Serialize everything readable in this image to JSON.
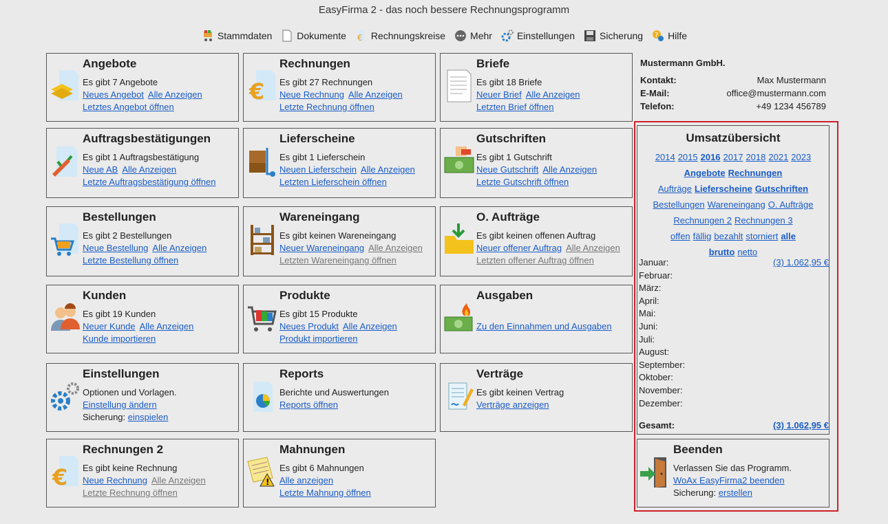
{
  "window": {
    "title": "EasyFirma 2 - das noch bessere Rechnungsprogramm"
  },
  "toolbar": [
    {
      "label": "Stammdaten",
      "icon": "shopping-cart-icon"
    },
    {
      "label": "Dokumente",
      "icon": "document-icon"
    },
    {
      "label": "Rechnungskreise",
      "icon": "euro-document-icon"
    },
    {
      "label": "Mehr",
      "icon": "more-icon"
    },
    {
      "label": "Einstellungen",
      "icon": "gear-icon"
    },
    {
      "label": "Sicherung",
      "icon": "save-icon"
    },
    {
      "label": "Hilfe",
      "icon": "help-icon"
    }
  ],
  "tiles": {
    "angebote": {
      "title": "Angebote",
      "desc": "Es gibt 7 Angebote",
      "new": "Neues Angebot",
      "all": "Alle Anzeigen",
      "last": "Letztes Angebot öffnen"
    },
    "rechnungen": {
      "title": "Rechnungen",
      "desc": "Es gibt 27 Rechnungen",
      "new": "Neue Rechnung",
      "all": "Alle Anzeigen",
      "last": "Letzte Rechnung öffnen"
    },
    "briefe": {
      "title": "Briefe",
      "desc": "Es gibt 18 Briefe",
      "new": "Neuer Brief",
      "all": "Alle Anzeigen",
      "last": "Letzten Brief öffnen"
    },
    "ab": {
      "title": "Auftragsbestätigungen",
      "desc": "Es gibt 1 Auftragsbestätigung",
      "new": "Neue AB",
      "all": "Alle Anzeigen",
      "last": "Letzte Auftragsbestätigung öffnen"
    },
    "lieferscheine": {
      "title": "Lieferscheine",
      "desc": "Es gibt 1 Lieferschein",
      "new": "Neuen Lieferschein",
      "all": "Alle Anzeigen",
      "last": "Letzten Lieferschein öffnen"
    },
    "gutschriften": {
      "title": "Gutschriften",
      "desc": "Es gibt 1 Gutschrift",
      "new": "Neue Gutschrift",
      "all": "Alle Anzeigen",
      "last": "Letzte Gutschrift öffnen"
    },
    "bestellungen": {
      "title": "Bestellungen",
      "desc": "Es gibt 2 Bestellungen",
      "new": "Neue Bestellung",
      "all": "Alle Anzeigen",
      "last": "Letzte Bestellung öffnen"
    },
    "wareneingang": {
      "title": "Wareneingang",
      "desc": "Es gibt keinen Wareneingang",
      "new": "Neuer Wareneingang",
      "all": "Alle Anzeigen",
      "last": "Letzten Wareneingang öffnen"
    },
    "oauftraege": {
      "title": "O. Aufträge",
      "desc": "Es gibt keinen offenen Auftrag",
      "new": "Neuer offener Auftrag",
      "all": "Alle Anzeigen",
      "last": "Letzten offener Auftrag öffnen"
    },
    "kunden": {
      "title": "Kunden",
      "desc": "Es gibt 19 Kunden",
      "new": "Neuer Kunde",
      "all": "Alle Anzeigen",
      "last": "Kunde importieren"
    },
    "produkte": {
      "title": "Produkte",
      "desc": "Es gibt 15 Produkte",
      "new": "Neues Produkt",
      "all": "Alle Anzeigen",
      "last": "Produkt importieren"
    },
    "ausgaben": {
      "title": "Ausgaben",
      "link": "Zu den Einnahmen und Ausgaben"
    },
    "einstellungen": {
      "title": "Einstellungen",
      "desc": "Optionen und Vorlagen.",
      "link": "Einstellung ändern",
      "sicherung_label": "Sicherung:",
      "sicherung_link": "einspielen"
    },
    "reports": {
      "title": "Reports",
      "desc": "Berichte und Auswertungen",
      "link": "Reports öffnen"
    },
    "vertraege": {
      "title": "Verträge",
      "desc": "Es gibt keinen Vertrag",
      "link": "Verträge anzeigen"
    },
    "rechnungen2": {
      "title": "Rechnungen 2",
      "desc": "Es gibt keine Rechnung",
      "new": "Neue Rechnung",
      "all": "Alle Anzeigen",
      "last": "Letzte Rechnung öffnen"
    },
    "mahnungen": {
      "title": "Mahnungen",
      "desc": "Es gibt 6 Mahnungen",
      "all": "Alle anzeigen",
      "last": "Letzte Mahnung öffnen"
    }
  },
  "company": {
    "name": "Mustermann GmbH.",
    "kontakt_label": "Kontakt:",
    "kontakt": "Max Mustermann",
    "email_label": "E-Mail:",
    "email": "office@mustermann.com",
    "telefon_label": "Telefon:",
    "telefon": "+49 1234 456789"
  },
  "umsatz": {
    "title": "Umsatzübersicht",
    "years": [
      "2014",
      "2015",
      "2016",
      "2017",
      "2018",
      "2021",
      "2023"
    ],
    "selected_year": "2016",
    "doc_types_row1": [
      "Angebote",
      "Rechnungen"
    ],
    "doc_types_row2": [
      "Aufträge",
      "Lieferscheine",
      "Gutschriften"
    ],
    "doc_types_row3": [
      "Bestellungen",
      "Wareneingang",
      "O. Aufträge"
    ],
    "doc_types_row4": [
      "Rechnungen 2",
      "Rechnungen 3"
    ],
    "status": [
      "offen",
      "fällig",
      "bezahlt",
      "storniert",
      "alle"
    ],
    "amount_type": [
      "brutto",
      "netto"
    ],
    "months": [
      {
        "name": "Januar:",
        "value": "(3)  1.062,95 €"
      },
      {
        "name": "Februar:",
        "value": ""
      },
      {
        "name": "März:",
        "value": ""
      },
      {
        "name": "April:",
        "value": ""
      },
      {
        "name": "Mai:",
        "value": ""
      },
      {
        "name": "Juni:",
        "value": ""
      },
      {
        "name": "Juli:",
        "value": ""
      },
      {
        "name": "August:",
        "value": ""
      },
      {
        "name": "September:",
        "value": ""
      },
      {
        "name": "Oktober:",
        "value": ""
      },
      {
        "name": "November:",
        "value": ""
      },
      {
        "name": "Dezember:",
        "value": ""
      }
    ],
    "total_label": "Gesamt:",
    "total_value": "(3) 1.062,95 €"
  },
  "beenden": {
    "title": "Beenden",
    "desc": "Verlassen Sie das Programm.",
    "link": "WoAx EasyFirma2 beenden",
    "sicherung_label": "Sicherung:",
    "sicherung_link": "erstellen"
  },
  "colors": {
    "link": "#1a5cc8",
    "highlight_border": "#d0202a",
    "background": "#eaeaea"
  }
}
